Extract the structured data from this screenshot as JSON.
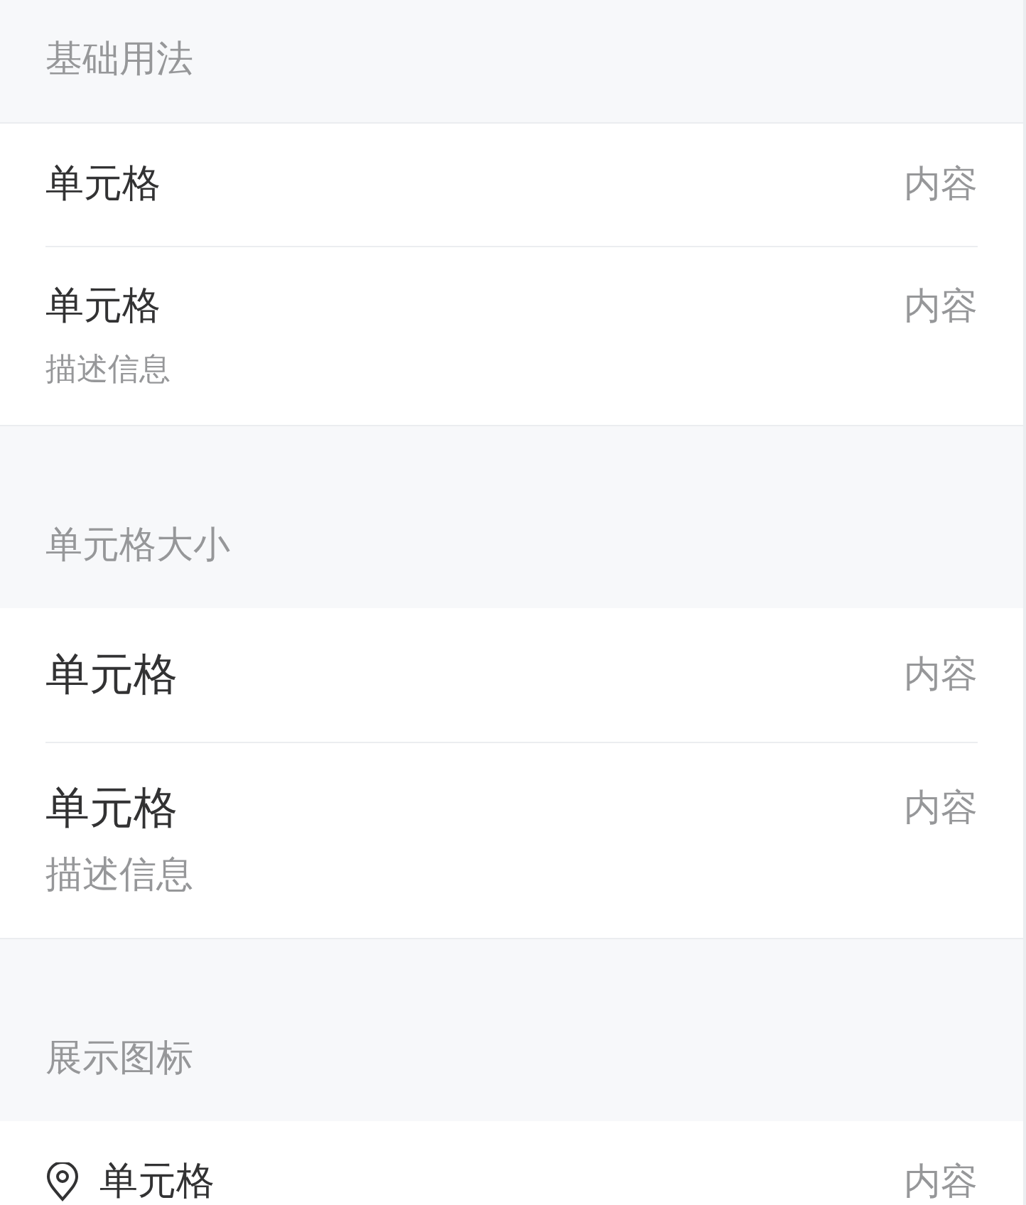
{
  "sections": [
    {
      "title": "基础用法",
      "kind": "normal",
      "cells": [
        {
          "kind": "plain",
          "title": "单元格",
          "value": "内容"
        },
        {
          "kind": "plain",
          "title": "单元格",
          "value": "内容",
          "label": "描述信息"
        }
      ]
    },
    {
      "title": "单元格大小",
      "kind": "large",
      "cells": [
        {
          "kind": "plain",
          "title": "单元格",
          "value": "内容"
        },
        {
          "kind": "plain",
          "title": "单元格",
          "value": "内容",
          "label": "描述信息"
        }
      ]
    },
    {
      "title": "展示图标",
      "kind": "normal",
      "cells": [
        {
          "kind": "icon",
          "title": "单元格",
          "value": "内容"
        }
      ]
    }
  ]
}
